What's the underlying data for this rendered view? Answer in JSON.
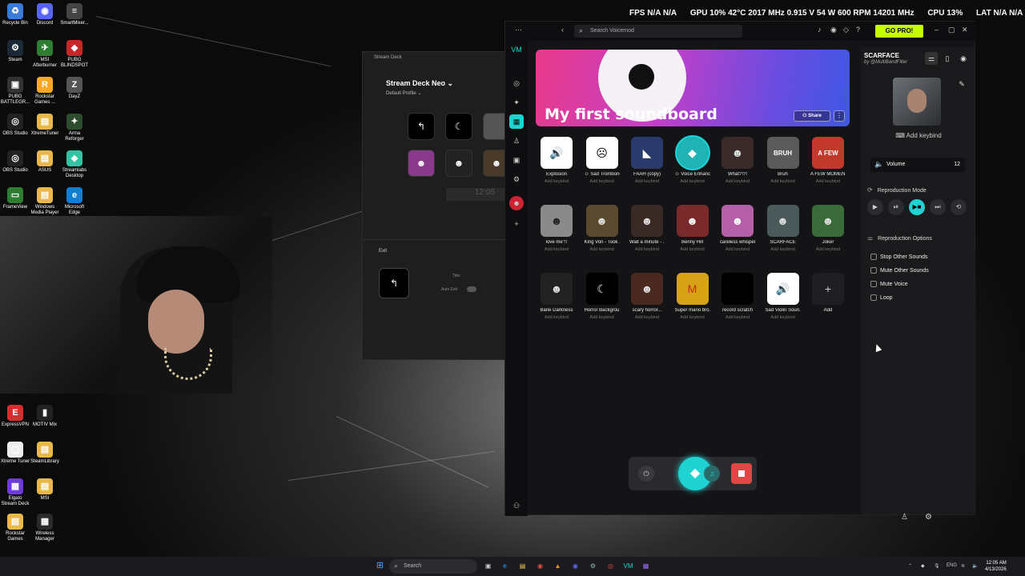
{
  "stats_overlay": {
    "fps": "FPS  N/A  N/A",
    "gpu": "GPU 10% 42°C 2017 MHz 0.915 V 54 W 600 RPM 14201 MHz",
    "cpu": "CPU 13%",
    "lat": "LAT  N/A  N/A"
  },
  "desktop_icons": [
    {
      "label": "Recycle Bin",
      "glyph": "♻",
      "color": "#3a7bd5"
    },
    {
      "label": "Discord",
      "glyph": "◉",
      "color": "#5865f2"
    },
    {
      "label": "SmartMixer...",
      "glyph": "≡",
      "color": "#444"
    },
    {
      "label": "Steam",
      "glyph": "⚙",
      "color": "#1b2838"
    },
    {
      "label": "MSI Afterburner",
      "glyph": "✈",
      "color": "#2e7d32"
    },
    {
      "label": "PUBG BLINDSPOT",
      "glyph": "◆",
      "color": "#c62828"
    },
    {
      "label": "PUBG BATTLEGR...",
      "glyph": "▣",
      "color": "#333"
    },
    {
      "label": "Rockstar Games ...",
      "glyph": "R",
      "color": "#f9a825"
    },
    {
      "label": "DayZ",
      "glyph": "Z",
      "color": "#555"
    },
    {
      "label": "OBS Studio",
      "glyph": "◎",
      "color": "#222"
    },
    {
      "label": "XtremeTuner",
      "glyph": "▤",
      "color": "#e8b84a"
    },
    {
      "label": "Arma Reforger",
      "glyph": "✦",
      "color": "#2e4d2e"
    },
    {
      "label": "OBS Studio",
      "glyph": "◎",
      "color": "#222"
    },
    {
      "label": "ASUS",
      "glyph": "▤",
      "color": "#e8b84a"
    },
    {
      "label": "Streamlabs Desktop",
      "glyph": "◈",
      "color": "#31c3a2"
    },
    {
      "label": "FrameView",
      "glyph": "▭",
      "color": "#2e7d32"
    },
    {
      "label": "Windows Media Player",
      "glyph": "▤",
      "color": "#e8b84a"
    },
    {
      "label": "Microsoft Edge",
      "glyph": "e",
      "color": "#0f7fd6"
    },
    {
      "label": "ExpressVPN",
      "glyph": "E",
      "color": "#d32f2f"
    },
    {
      "label": "MOTIV Mix",
      "glyph": "▮",
      "color": "#222"
    },
    {
      "label": "Xtreme Tuner",
      "glyph": "▢",
      "color": "#eee"
    },
    {
      "label": "SteamLibrary",
      "glyph": "▤",
      "color": "#e8b84a"
    },
    {
      "label": "Elgato Stream Deck",
      "glyph": "▦",
      "color": "#6d3bd6"
    },
    {
      "label": "MSI",
      "glyph": "▤",
      "color": "#e8b84a"
    },
    {
      "label": "Rockstar Games",
      "glyph": "▤",
      "color": "#e8b84a"
    },
    {
      "label": "Wireless Manager",
      "glyph": "▦",
      "color": "#2a2a2a"
    }
  ],
  "stream_deck": {
    "window_title": "Stream Deck",
    "device_name": "Stream Deck Neo ⌄",
    "profile": "Default Profile ⌄",
    "clock": "12:05",
    "exit_label": "Exit",
    "title_label": "Title:",
    "auto_exit_label": "Auto Exit"
  },
  "voicemod": {
    "search_placeholder": "Search Voicemod",
    "go_pro": "GO PRO!",
    "banner_title": "My first soundboard",
    "share": "Share",
    "add_keybind": "Add keybind",
    "add_label": "Add",
    "sounds": [
      {
        "name": "Explosion",
        "glyph": "🔊",
        "bg": "#ffffff",
        "fg": "#000"
      },
      {
        "name": "☺ Sad Trombone",
        "glyph": "☹",
        "bg": "#ffffff",
        "fg": "#000"
      },
      {
        "name": "FAAH (copy)",
        "glyph": "◣",
        "bg": "#2a3a6a",
        "fg": "#fff"
      },
      {
        "name": "☺ Voice Enhancer",
        "glyph": "◆",
        "bg": "#1fb3b3",
        "fg": "#fff",
        "active": true
      },
      {
        "name": "What?!?!",
        "glyph": "☻",
        "bg": "#3a2a2a",
        "fg": "#ddd"
      },
      {
        "name": "Bruh",
        "glyph": "BRUH",
        "bg": "#5a5a5a",
        "fg": "#fff"
      },
      {
        "name": "A FEW MOMEN...",
        "glyph": "A FEW",
        "bg": "#c0392b",
        "fg": "#fff"
      },
      {
        "name": "love me\"!!",
        "glyph": "☻",
        "bg": "#8a8a8a",
        "fg": "#222"
      },
      {
        "name": "King Von - Took ...",
        "glyph": "☻",
        "bg": "#5a4a30",
        "fg": "#ddd"
      },
      {
        "name": "Wait a minute - ...",
        "glyph": "☻",
        "bg": "#3a2a25",
        "fg": "#ddd"
      },
      {
        "name": "Benny Hill",
        "glyph": "☻",
        "bg": "#7a2a2a",
        "fg": "#fff"
      },
      {
        "name": "careless whisper",
        "glyph": "☻",
        "bg": "#b45fa8",
        "fg": "#fff"
      },
      {
        "name": "SCARFACE",
        "glyph": "☻",
        "bg": "#4a5a5a",
        "fg": "#ddd"
      },
      {
        "name": "Joker",
        "glyph": "☻",
        "bg": "#3a6a3a",
        "fg": "#ddd"
      },
      {
        "name": "Bane Darkness",
        "glyph": "☻",
        "bg": "#222",
        "fg": "#ddd"
      },
      {
        "name": "Horror Backgrou...",
        "glyph": "☾",
        "bg": "#000",
        "fg": "#fff"
      },
      {
        "name": "scary horror...",
        "glyph": "☻",
        "bg": "#4a2a20",
        "fg": "#ddd"
      },
      {
        "name": "Super mario bro...",
        "glyph": "M",
        "bg": "#d6a216",
        "fg": "#c62828"
      },
      {
        "name": "record scratch",
        "glyph": "",
        "bg": "#000",
        "fg": "#fff"
      },
      {
        "name": "Sad Violin Soun...",
        "glyph": "🔊",
        "bg": "#ffffff",
        "fg": "#000"
      }
    ],
    "right_panel": {
      "title": "SCARFACE",
      "by": "by @MultiBandFilter",
      "add_keybind": "Add keybind",
      "volume_label": "Volume",
      "volume_value": "12",
      "reproduction_mode": "Reproduction Mode",
      "reproduction_options": "Reproduction Options",
      "options": [
        "Stop Other Sounds",
        "Mute Other Sounds",
        "Mute Voice",
        "Loop"
      ]
    }
  },
  "taskbar": {
    "search_placeholder": "Search",
    "lang": "ENG",
    "time": "12:05 AM",
    "date": "4/13/2026"
  }
}
